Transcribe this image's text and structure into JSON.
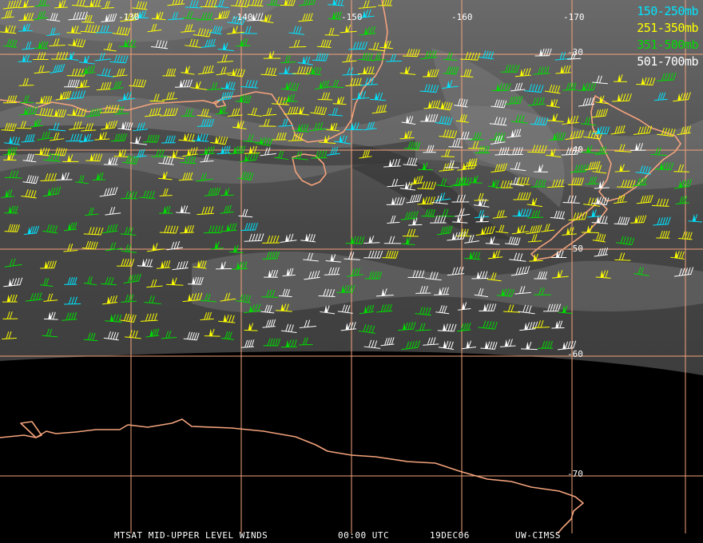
{
  "title": "MTSAT MID-UPPER LEVEL WINDS",
  "time": "00:00 UTC",
  "date": "19DEC06",
  "source": "UW-CIMSS",
  "legend": [
    {
      "label": "150-250mb",
      "color": "#00e5ff"
    },
    {
      "label": "251-350mb",
      "color": "#ffff00"
    },
    {
      "label": "351-500mb",
      "color": "#00dd00"
    },
    {
      "label": "501-700mb",
      "color": "#ffffff"
    }
  ],
  "longitude_labels": [
    "-130",
    "-140",
    "-150",
    "-160",
    "-170"
  ],
  "latitude_labels": [
    "-30",
    "-40",
    "-50",
    "-60",
    "-70"
  ],
  "grid_color": "#f4a37c",
  "coast_color": "#f4a37c"
}
